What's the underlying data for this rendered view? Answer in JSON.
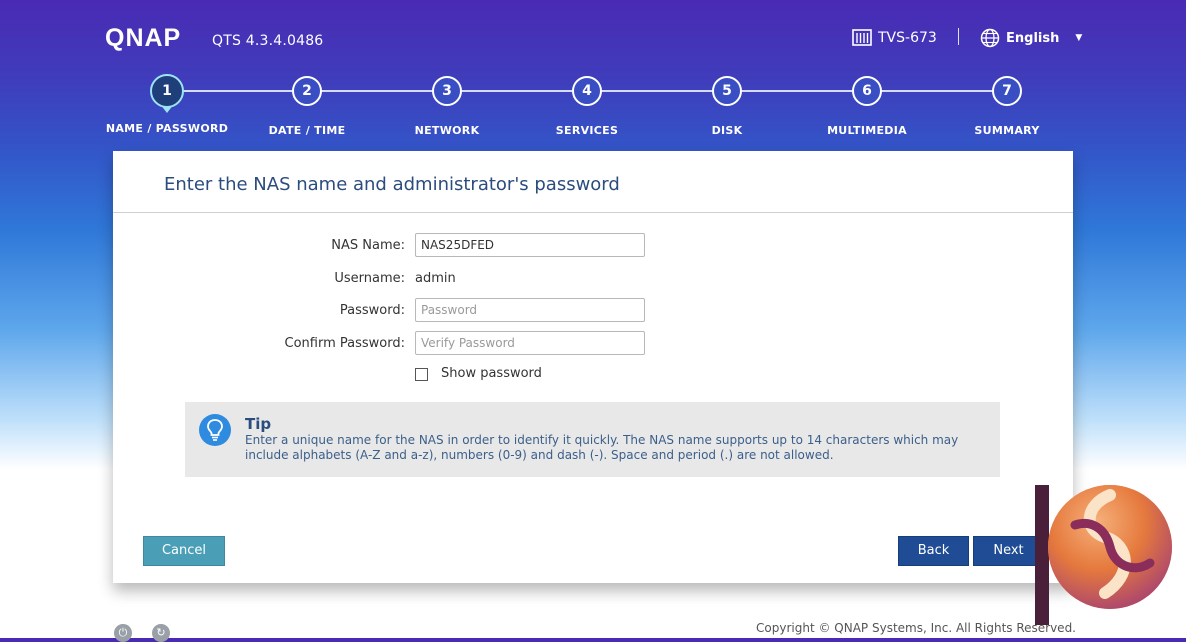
{
  "header": {
    "brand": "QNAP",
    "version": "QTS 4.3.4.0486",
    "model": "TVS-673",
    "language": "English"
  },
  "steps": [
    {
      "number": "1",
      "label": "NAME / PASSWORD",
      "active": true
    },
    {
      "number": "2",
      "label": "DATE / TIME"
    },
    {
      "number": "3",
      "label": "NETWORK"
    },
    {
      "number": "4",
      "label": "SERVICES"
    },
    {
      "number": "5",
      "label": "DISK"
    },
    {
      "number": "6",
      "label": "MULTIMEDIA"
    },
    {
      "number": "7",
      "label": "SUMMARY"
    }
  ],
  "form": {
    "title": "Enter the NAS name and administrator's password",
    "nas_name_label": "NAS Name:",
    "nas_name_value": "NAS25DFED",
    "username_label": "Username:",
    "username_value": "admin",
    "password_label": "Password:",
    "password_placeholder": "Password",
    "confirm_label": "Confirm Password:",
    "confirm_placeholder": "Verify Password",
    "show_password_label": "Show password"
  },
  "tip": {
    "title": "Tip",
    "text": "Enter a unique name for the NAS in order to identify it quickly. The NAS name supports up to 14 characters which may include alphabets (A-Z and a-z), numbers (0-9) and dash (-). Space and period (.) are not allowed."
  },
  "buttons": {
    "cancel": "Cancel",
    "back": "Back",
    "next": "Next"
  },
  "footer": {
    "copyright": "Copyright © QNAP Systems, Inc. All Rights Reserved."
  },
  "icons": {
    "model": "nas-device-icon",
    "language": "globe-icon",
    "tip": "lightbulb-icon",
    "footer_left": "power-icon",
    "footer_right": "restart-icon"
  },
  "colors": {
    "accent": "#1f4c94",
    "cancel": "#4a9fb6",
    "active_step": "#9de3f6"
  }
}
